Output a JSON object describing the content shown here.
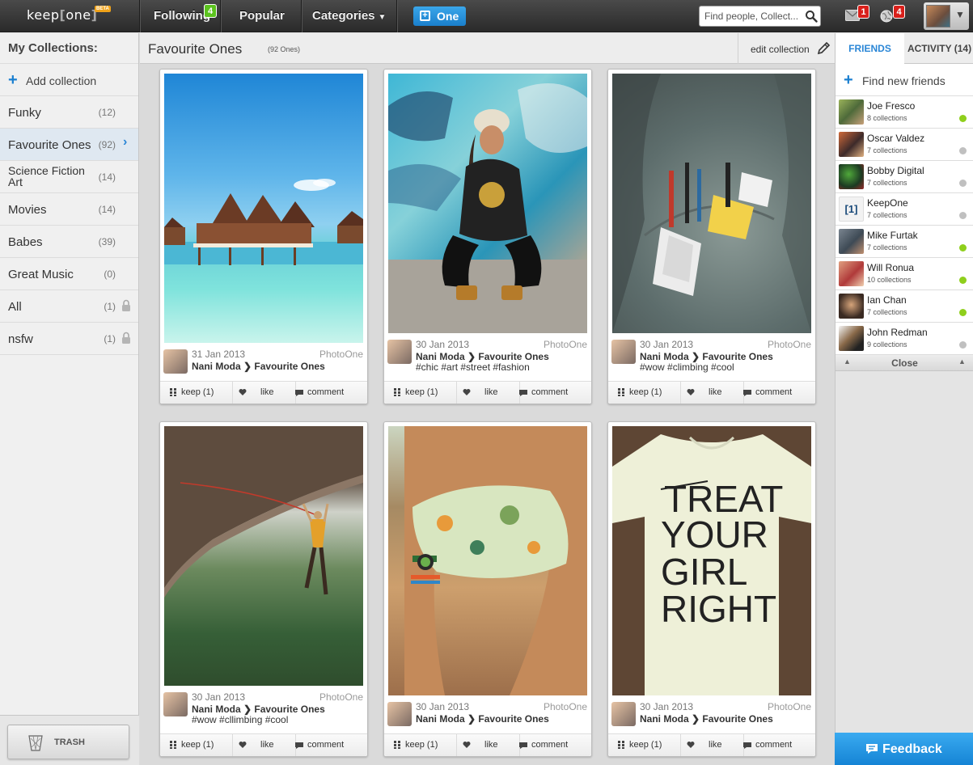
{
  "brand": {
    "logo_text": "keep",
    "logo_bracket_open": "[",
    "logo_text2": "one",
    "logo_bracket_close": "]",
    "badge": "BETA"
  },
  "nav": {
    "following": "Following",
    "following_count": "4",
    "popular": "Popular",
    "categories": "Categories",
    "one_button": "One"
  },
  "search": {
    "placeholder": "Find people, Collect..."
  },
  "notifications": {
    "mail_count": "1",
    "globe_count": "4"
  },
  "colors": {
    "accent": "#2a86d6",
    "badge_red": "#d9201b",
    "badge_green": "#5cc31f",
    "online": "#8fcf1c",
    "offline": "#c0c0c0"
  },
  "sidebar": {
    "title": "My Collections:",
    "add_label": "Add collection",
    "items": [
      {
        "name": "Funky",
        "count": "(12)"
      },
      {
        "name": "Favourite Ones",
        "count": "(92)",
        "active": true
      },
      {
        "name": "Science Fiction Art",
        "count": "(14)"
      },
      {
        "name": "Movies",
        "count": "(14)"
      },
      {
        "name": "Babes",
        "count": "(39)"
      },
      {
        "name": "Great Music",
        "count": "(0)"
      },
      {
        "name": "All",
        "count": "(1)",
        "locked": true
      },
      {
        "name": "nsfw",
        "count": "(1)",
        "locked": true
      }
    ],
    "trash_label": "TRASH"
  },
  "main": {
    "title": "Favourite Ones",
    "count_label": "(92 Ones)",
    "edit_label": "edit collection"
  },
  "cards": [
    {
      "date": "31 Jan 2013",
      "source": "PhotoOne",
      "user": "Nani Moda",
      "collection": "Favourite Ones",
      "tags": "",
      "kept": "1",
      "keep_label": "keep (1)",
      "like_label": "like",
      "comment_label": "comment"
    },
    {
      "date": "30 Jan 2013",
      "source": "PhotoOne",
      "user": "Nani Moda",
      "collection": "Favourite Ones",
      "tags": "#chic #art #street #fashion",
      "kept": "1",
      "keep_label": "keep (1)",
      "like_label": "like",
      "comment_label": "comment"
    },
    {
      "date": "30 Jan 2013",
      "source": "PhotoOne",
      "user": "Nani Moda",
      "collection": "Favourite Ones",
      "tags": "#wow #climbing #cool",
      "kept": "1",
      "keep_label": "keep (1)",
      "like_label": "like",
      "comment_label": "comment"
    },
    {
      "date": "30 Jan 2013",
      "source": "PhotoOne",
      "user": "Nani Moda",
      "collection": "Favourite Ones",
      "tags": "#wow #cllimbing #cool",
      "kept": "1",
      "keep_label": "keep (1)",
      "like_label": "like",
      "comment_label": "comment"
    },
    {
      "date": "30 Jan 2013",
      "source": "PhotoOne",
      "user": "Nani Moda",
      "collection": "Favourite Ones",
      "tags": "",
      "kept": "1",
      "keep_label": "keep (1)",
      "like_label": "like",
      "comment_label": "comment"
    },
    {
      "date": "30 Jan 2013",
      "source": "PhotoOne",
      "user": "Nani Moda",
      "collection": "Favourite Ones",
      "tags": "",
      "kept": "1",
      "keep_label": "keep (1)",
      "like_label": "like",
      "comment_label": "comment",
      "shirt_text": [
        "TREAT",
        "YOUR",
        "GIRL",
        "RIGHT"
      ]
    }
  ],
  "rpanel": {
    "tab_friends": "FRIENDS",
    "tab_activity": "ACTIVITY (14)",
    "find_label": "Find new friends",
    "friends": [
      {
        "name": "Joe Fresco",
        "sub": "8 collections",
        "online": true
      },
      {
        "name": "Oscar Valdez",
        "sub": "7 collections",
        "online": false
      },
      {
        "name": "Bobby Digital",
        "sub": "7 collections",
        "online": false
      },
      {
        "name": "KeepOne",
        "sub": "7 collections",
        "online": false,
        "logo": true
      },
      {
        "name": "Mike Furtak",
        "sub": "7 collections",
        "online": true
      },
      {
        "name": "Will Ronua",
        "sub": "10 collections",
        "online": true
      },
      {
        "name": "Ian Chan",
        "sub": "7 collections",
        "online": true
      },
      {
        "name": "John Redman",
        "sub": "9 collections",
        "online": false
      }
    ],
    "close_label": "Close"
  },
  "feedback_label": "Feedback"
}
